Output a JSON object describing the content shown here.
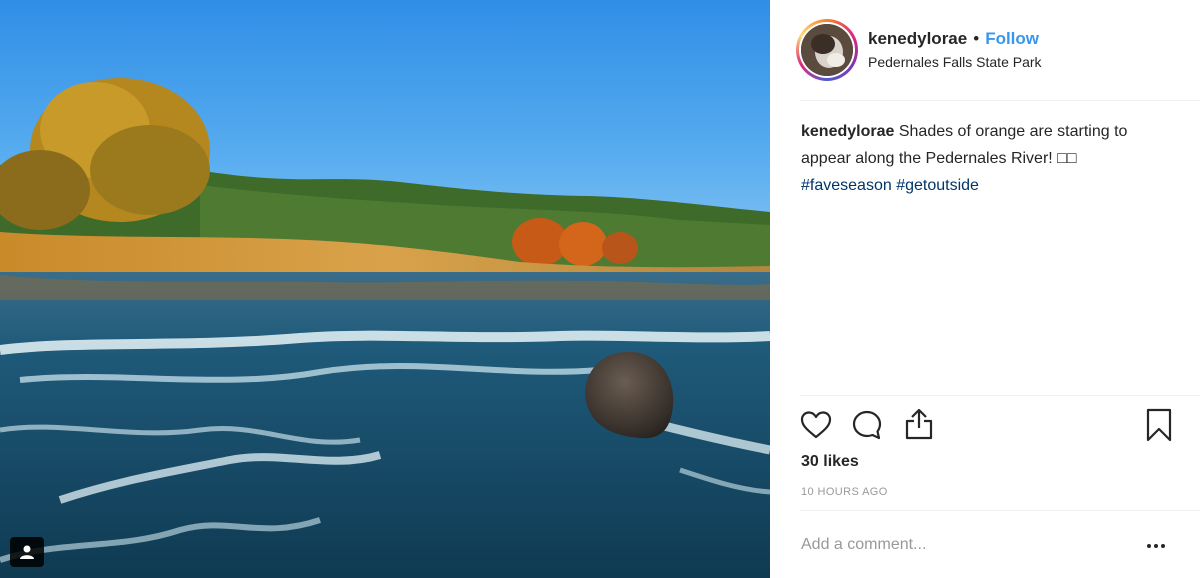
{
  "post": {
    "username": "kenedylorae",
    "separator": "•",
    "follow_label": "Follow",
    "location": "Pedernales Falls State Park",
    "caption": {
      "username": "kenedylorae",
      "text": "Shades of orange are starting to appear along the Pedernales River! □□",
      "hashtags": [
        "#faveseason",
        "#getoutside"
      ]
    },
    "likes": "30 likes",
    "timestamp": "10 HOURS AGO",
    "comment_placeholder": "Add a comment..."
  },
  "icons": {
    "tag": "user-tag-icon",
    "like": "heart-icon",
    "comment": "comment-bubble-icon",
    "share": "share-icon",
    "save": "bookmark-icon",
    "more": "more-options-icon"
  },
  "colors": {
    "follow": "#3897f0",
    "hashtag": "#003569",
    "muted": "#999999",
    "text": "#262626"
  }
}
